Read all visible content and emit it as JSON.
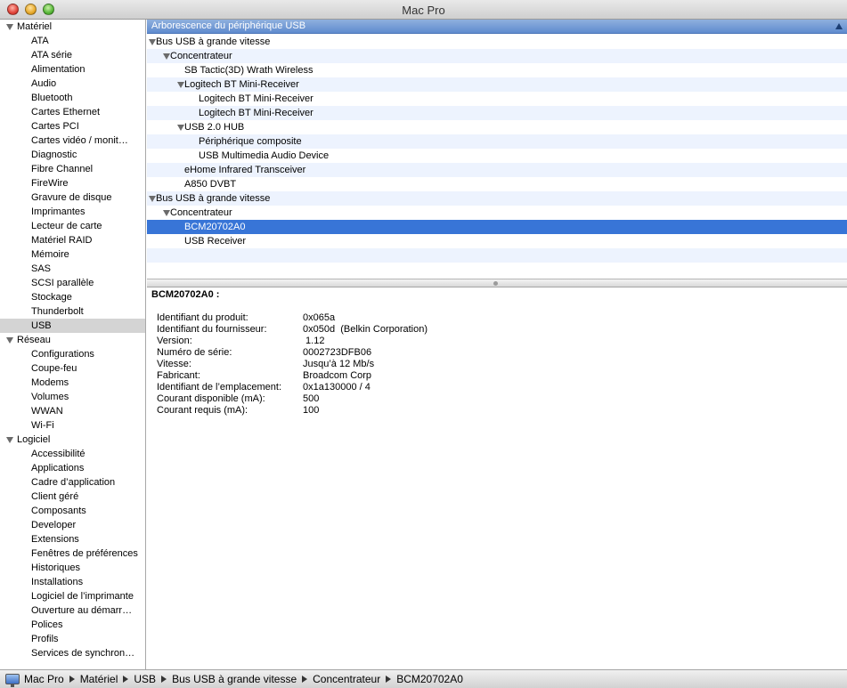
{
  "window": {
    "title": "Mac Pro"
  },
  "sidebar": {
    "sections": [
      {
        "label": "Matériel",
        "items": [
          "ATA",
          "ATA série",
          "Alimentation",
          "Audio",
          "Bluetooth",
          "Cartes Ethernet",
          "Cartes PCI",
          "Cartes vidéo / monit…",
          "Diagnostic",
          "Fibre Channel",
          "FireWire",
          "Gravure de disque",
          "Imprimantes",
          "Lecteur de carte",
          "Matériel RAID",
          "Mémoire",
          "SAS",
          "SCSI parallèle",
          "Stockage",
          "Thunderbolt",
          "USB"
        ]
      },
      {
        "label": "Réseau",
        "items": [
          "Configurations",
          "Coupe-feu",
          "Modems",
          "Volumes",
          "WWAN",
          "Wi-Fi"
        ]
      },
      {
        "label": "Logiciel",
        "items": [
          "Accessibilité",
          "Applications",
          "Cadre d’application",
          "Client géré",
          "Composants",
          "Developer",
          "Extensions",
          "Fenêtres de préférences",
          "Historiques",
          "Installations",
          "Logiciel de l’imprimante",
          "Ouverture au démarr…",
          "Polices",
          "Profils",
          "Services de synchron…"
        ]
      }
    ],
    "selected": "USB"
  },
  "tree": {
    "header": "Arborescence du périphérique USB",
    "rows": [
      {
        "label": "Bus USB à grande vitesse",
        "level": 0,
        "expanded": true
      },
      {
        "label": "Concentrateur",
        "level": 1,
        "expanded": true
      },
      {
        "label": "SB Tactic(3D) Wrath Wireless",
        "level": 2
      },
      {
        "label": "Logitech BT Mini-Receiver",
        "level": 2,
        "expanded": true
      },
      {
        "label": "Logitech BT Mini-Receiver",
        "level": 3
      },
      {
        "label": "Logitech BT Mini-Receiver",
        "level": 3
      },
      {
        "label": "USB 2.0 HUB",
        "level": 2,
        "expanded": true
      },
      {
        "label": "Périphérique composite",
        "level": 3
      },
      {
        "label": "USB Multimedia Audio Device",
        "level": 3
      },
      {
        "label": "eHome Infrared Transceiver",
        "level": 2
      },
      {
        "label": "A850 DVBT",
        "level": 2
      },
      {
        "label": "Bus USB à grande vitesse",
        "level": 0,
        "expanded": true
      },
      {
        "label": "Concentrateur",
        "level": 1,
        "expanded": true
      },
      {
        "label": "BCM20702A0",
        "level": 2,
        "selected": true
      },
      {
        "label": "USB Receiver",
        "level": 2
      }
    ]
  },
  "detail": {
    "title": "BCM20702A0 :",
    "properties": [
      {
        "key": "Identifiant du produit:",
        "value": "0x065a"
      },
      {
        "key": "Identifiant du fournisseur:",
        "value": "0x050d  (Belkin Corporation)"
      },
      {
        "key": "Version:",
        "value": " 1.12"
      },
      {
        "key": "Numéro de série:",
        "value": "0002723DFB06"
      },
      {
        "key": "Vitesse:",
        "value": "Jusqu’à 12 Mb/s"
      },
      {
        "key": "Fabricant:",
        "value": "Broadcom Corp"
      },
      {
        "key": "Identifiant de l’emplacement:",
        "value": "0x1a130000 / 4"
      },
      {
        "key": "Courant disponible (mA):",
        "value": "500"
      },
      {
        "key": "Courant requis (mA):",
        "value": "100"
      }
    ]
  },
  "pathbar": {
    "icon": "mac-pro-icon",
    "crumbs": [
      "Mac Pro",
      "Matériel",
      "USB",
      "Bus USB à grande vitesse",
      "Concentrateur",
      "BCM20702A0"
    ]
  },
  "colors": {
    "selection": "#3875d7",
    "header": "#6f97d6",
    "stripe": "#edf3fe"
  }
}
